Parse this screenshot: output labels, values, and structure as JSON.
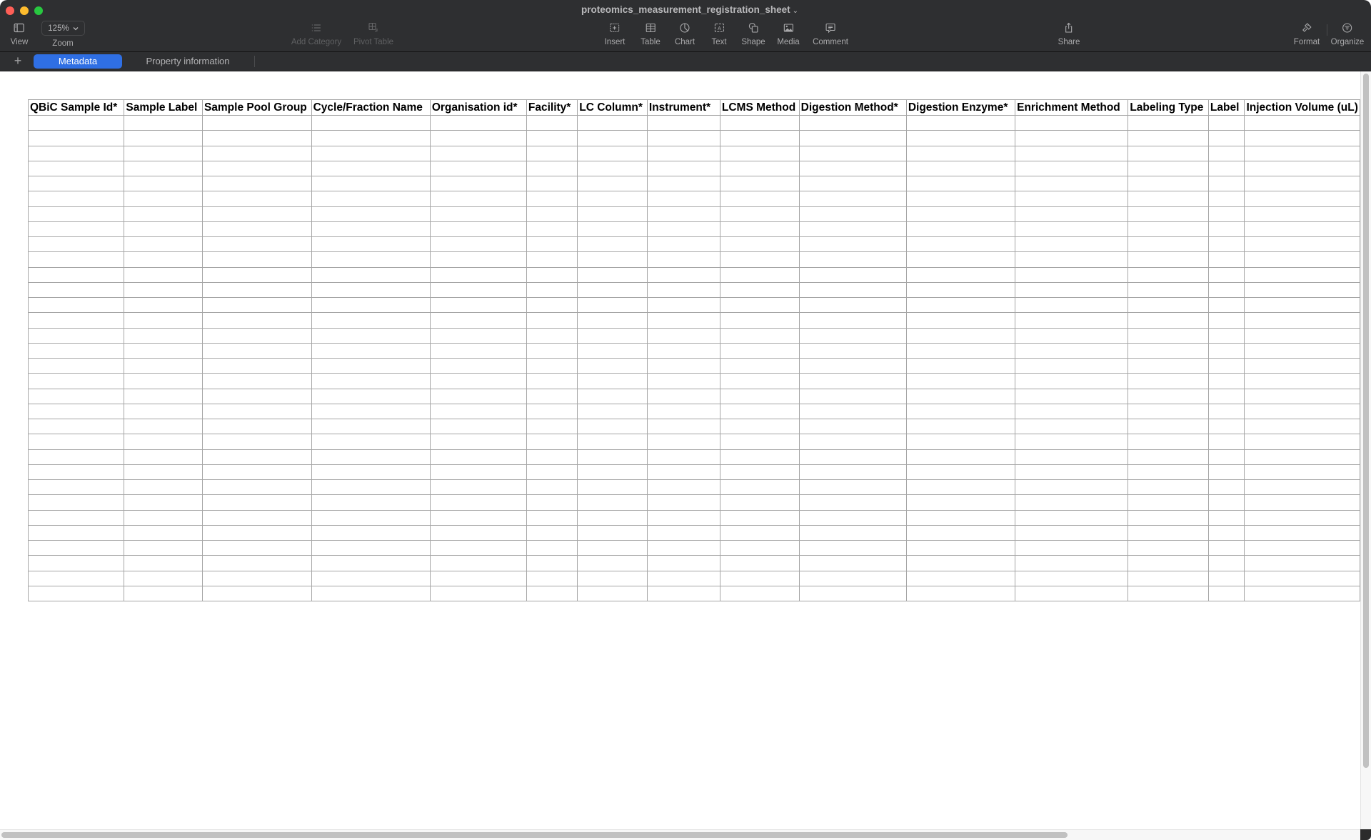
{
  "window": {
    "title": "proteomics_measurement_registration_sheet",
    "title_chevron": "⌄"
  },
  "toolbar": {
    "view": {
      "label": "View",
      "icon": "sidebar-icon"
    },
    "zoom": {
      "label": "Zoom",
      "value": "125%",
      "icon": "chevron-down-icon"
    },
    "add_category": {
      "label": "Add Category",
      "icon": "list-icon",
      "enabled": false
    },
    "pivot_table": {
      "label": "Pivot Table",
      "icon": "pivot-table-icon",
      "enabled": false
    },
    "insert": {
      "label": "Insert",
      "icon": "insert-icon"
    },
    "table": {
      "label": "Table",
      "icon": "table-icon"
    },
    "chart": {
      "label": "Chart",
      "icon": "chart-icon"
    },
    "text": {
      "label": "Text",
      "icon": "text-box-icon"
    },
    "shape": {
      "label": "Shape",
      "icon": "shape-icon"
    },
    "media": {
      "label": "Media",
      "icon": "media-icon"
    },
    "comment": {
      "label": "Comment",
      "icon": "comment-icon"
    },
    "share": {
      "label": "Share",
      "icon": "share-icon"
    },
    "format": {
      "label": "Format",
      "icon": "paintbrush-icon"
    },
    "organize": {
      "label": "Organize",
      "icon": "organize-icon"
    }
  },
  "sheets": {
    "add_label": "+",
    "tabs": [
      {
        "label": "Metadata",
        "active": true
      },
      {
        "label": "Property information",
        "active": false
      }
    ]
  },
  "table": {
    "headers": [
      "QBiC Sample Id*",
      "Sample Label",
      "Sample Pool Group",
      "Cycle/Fraction Name",
      "Organisation id*",
      "Facility*",
      "LC Column*",
      "Instrument*",
      "LCMS Method",
      "Digestion Method*",
      "Digestion Enzyme*",
      "Enrichment Method",
      "Labeling Type",
      "Label",
      "Injection Volume (uL)"
    ],
    "empty_row_count": 32
  },
  "colors": {
    "toolbar_bg": "#2e2f31",
    "active_tab": "#2f6fe4",
    "grid_line": "#a6a6a6"
  }
}
